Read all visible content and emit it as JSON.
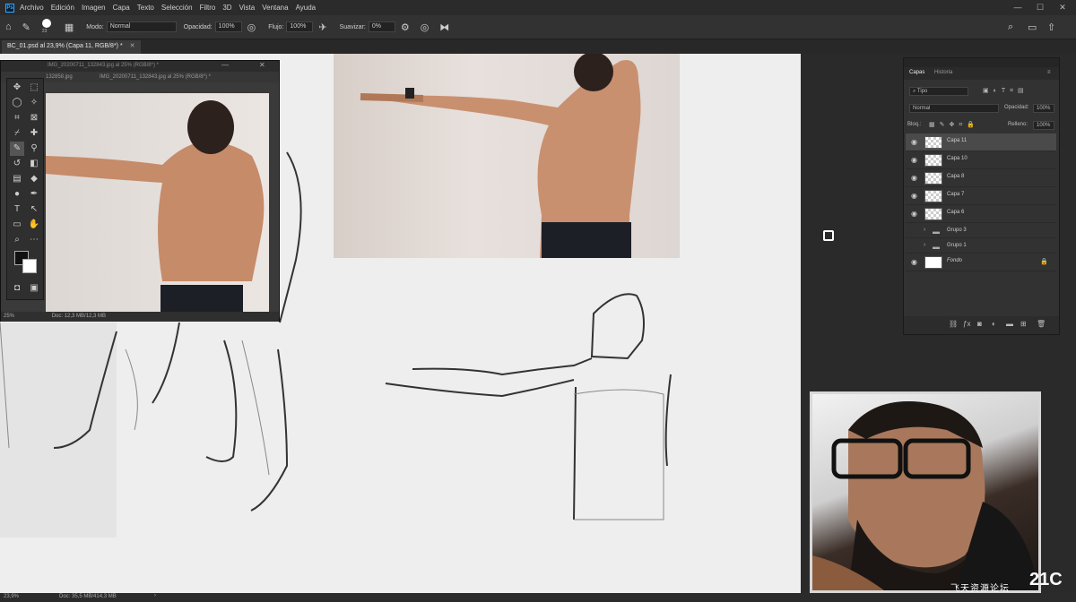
{
  "app": {
    "logo": "Ps"
  },
  "menu": [
    "Archivo",
    "Edición",
    "Imagen",
    "Capa",
    "Texto",
    "Selección",
    "Filtro",
    "3D",
    "Vista",
    "Ventana",
    "Ayuda"
  ],
  "window_controls": {
    "minimize": "—",
    "maximize": "☐",
    "close": "✕"
  },
  "options": {
    "brush_size": "23",
    "mode_label": "Modo:",
    "mode_value": "Normal",
    "opacity_label": "Opacidad:",
    "opacity_value": "100%",
    "flow_label": "Flujo:",
    "flow_value": "100%",
    "smooth_label": "Suavizar:",
    "smooth_value": "0%"
  },
  "document_tab": {
    "title": "BC_01.psd al 23,9% (Capa 11, RGB/8*) *",
    "close": "✕"
  },
  "floating_window": {
    "tab1": "IMG_20200711_132843.jpg al 25% (RGB/8*) *",
    "tab2_a": "132858.jpg",
    "tab2_b": "IMG_20200711_132843.jpg al 25% (RGB/8*) *",
    "zoom": "25%",
    "doc_info": "Doc: 12,3 MB/12,3 MB"
  },
  "layers_panel": {
    "tab_layers": "Capas",
    "tab_history": "Historia",
    "filter_label": "Tipo",
    "blend_mode": "Normal",
    "opacity_label": "Opacidad:",
    "opacity_value": "100%",
    "lock_label": "Bloq.:",
    "fill_label": "Relleno:",
    "fill_value": "100%",
    "layers": [
      {
        "name": "Capa 11",
        "active": true,
        "type": "layer",
        "visible": true
      },
      {
        "name": "Capa 10",
        "active": false,
        "type": "layer",
        "visible": true
      },
      {
        "name": "Capa 8",
        "active": false,
        "type": "layer",
        "visible": true
      },
      {
        "name": "Capa 7",
        "active": false,
        "type": "layer",
        "visible": true
      },
      {
        "name": "Capa 6",
        "active": false,
        "type": "layer",
        "visible": true
      },
      {
        "name": "Grupo 3",
        "active": false,
        "type": "group",
        "visible": false
      },
      {
        "name": "Grupo 1",
        "active": false,
        "type": "group",
        "visible": false
      },
      {
        "name": "Fondo",
        "active": false,
        "type": "background",
        "visible": true
      }
    ]
  },
  "status_bar": {
    "zoom": "23,9%",
    "doc_info": "Doc: 35,5 MB/414,3 MB"
  },
  "watermark": {
    "text": "飞天资源论坛",
    "logo": "21C"
  },
  "colors": {
    "accent": "#31a8ff",
    "background": "#282828",
    "canvas": "#eeeeee"
  }
}
